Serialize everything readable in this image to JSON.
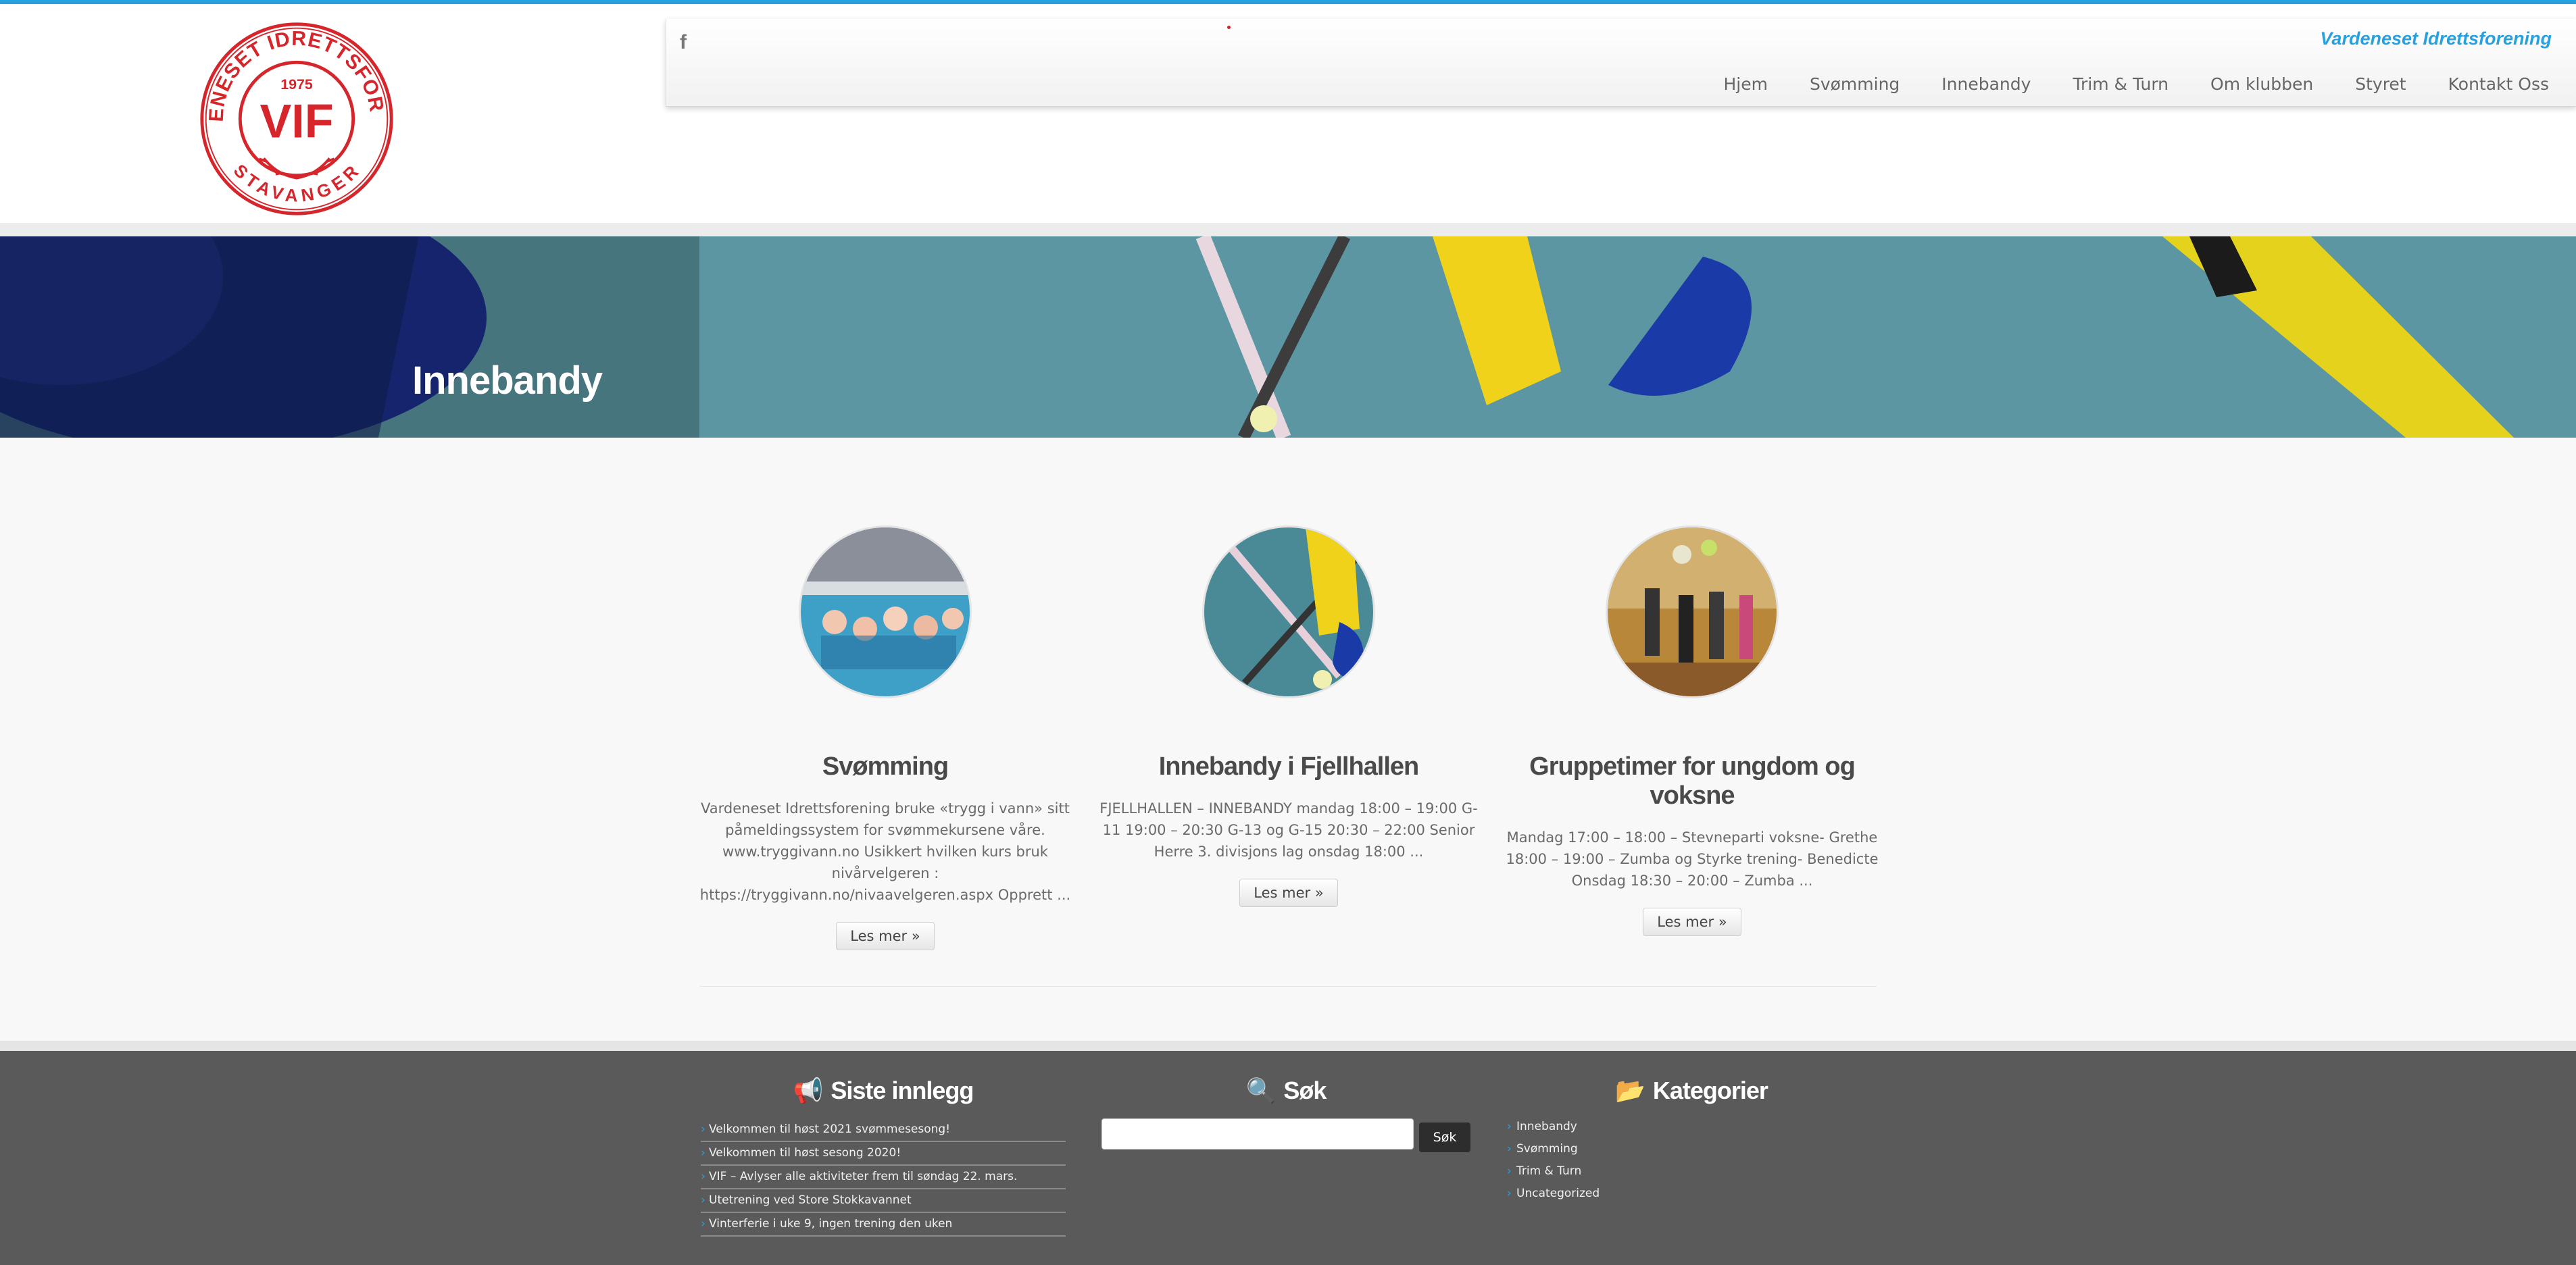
{
  "header": {
    "site_tagline": "Vardeneset Idrettsforening",
    "logo": {
      "ring_text": "VARDENESET IDRETTSFORENING",
      "year": "1975",
      "initials": "VIF",
      "city": "STAVANGER",
      "color": "#d7262b"
    },
    "social_icon": "facebook-icon",
    "menu": [
      "Hjem",
      "Svømming",
      "Innebandy",
      "Trim & Turn",
      "Om klubben",
      "Styret",
      "Kontakt Oss"
    ]
  },
  "banner": {
    "title": "Innebandy"
  },
  "cards": [
    {
      "title": "Svømming",
      "excerpt": "Vardeneset Idrettsforening bruke «trygg i vann» sitt påmeldingssystem for svømmekursene våre. www.tryggivann.no Usikkert hvilken kurs bruk nivårvelgeren : https://tryggivann.no/nivaavelgeren.aspx   Opprett ...",
      "button": "Les mer »"
    },
    {
      "title": "Innebandy i Fjellhallen",
      "excerpt": "FJELLHALLEN – INNEBANDY    mandag      18:00 – 19:00      G-11 19:00 – 20:30      G-13 og G-15    20:30 – 22:00      Senior Herre 3. divisjons lag onsdag 18:00 ...",
      "button": "Les mer »"
    },
    {
      "title": "Gruppetimer for ungdom og voksne",
      "excerpt": "Mandag    17:00 – 18:00 –  Stevneparti voksne- Grethe 18:00 – 19:00 –  Zumba og Styrke trening- Benedicte   Onsdag   18:30 – 20:00 –  Zumba ...",
      "button": "Les mer »"
    }
  ],
  "footer": {
    "recent": {
      "title": "Siste innlegg",
      "icon": "megaphone-icon",
      "items": [
        "Velkommen til høst 2021 svømmesesong!",
        "Velkommen til høst sesong 2020!",
        "VIF – Avlyser alle aktiviteter frem til søndag 22. mars.",
        "Utetrening ved Store Stokkavannet",
        "Vinterferie i uke 9, ingen trening den uken"
      ]
    },
    "search": {
      "title": "Søk",
      "icon": "search-icon",
      "placeholder": "",
      "button": "Søk"
    },
    "categories": {
      "title": "Kategorier",
      "icon": "folder-open-icon",
      "items": [
        "Innebandy",
        "Svømming",
        "Trim & Turn",
        "Uncategorized"
      ]
    }
  },
  "colors": {
    "accent": "#27a0e0",
    "footer_bg": "#5a5a5a",
    "logo_red": "#d7262b"
  }
}
